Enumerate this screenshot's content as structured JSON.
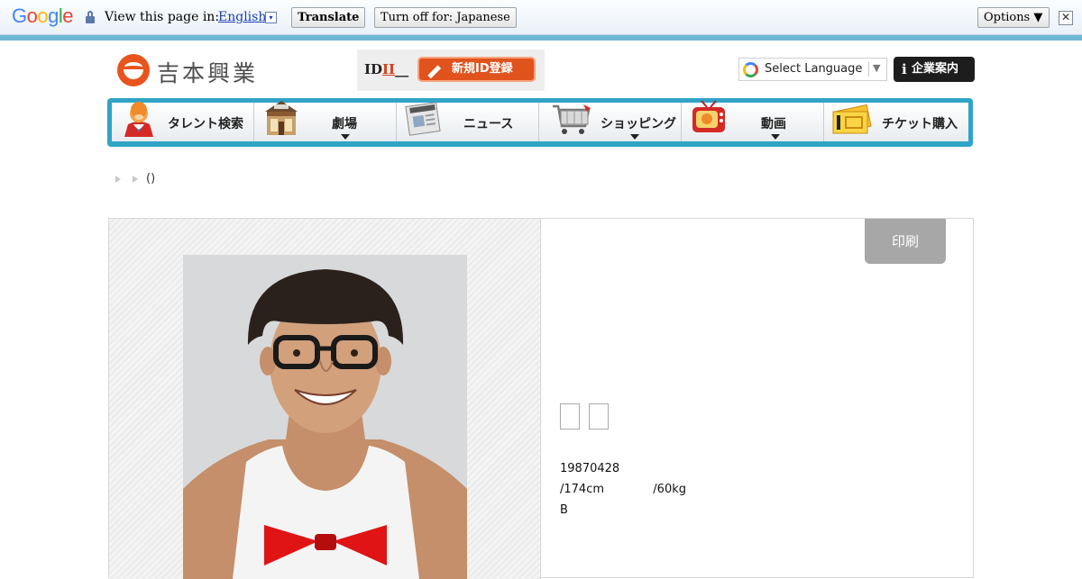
{
  "translate_bar": {
    "brand": "Google",
    "prompt": "View this page in:",
    "language": "English",
    "language_dropdown": "▾",
    "translate_label": "Translate",
    "turn_off_label": "Turn off for: Japanese",
    "options_label": "Options ▼",
    "close_label": "✕"
  },
  "header": {
    "logo_text": "吉本興業",
    "id_prefix": "ID",
    "id_suffix": "II",
    "register_label": "新規ID登録",
    "language_select": "Select Language",
    "language_arrow": "▼",
    "corporate_label": "企業案内",
    "corporate_icon": "i"
  },
  "nav": {
    "items": [
      {
        "label": "タレント検索",
        "icon": "talent-search-icon",
        "has_dropdown": false
      },
      {
        "label": "劇場",
        "icon": "theater-icon",
        "has_dropdown": true
      },
      {
        "label": "ニュース",
        "icon": "news-icon",
        "has_dropdown": false
      },
      {
        "label": "ショッピング",
        "icon": "shopping-cart-icon",
        "has_dropdown": true
      },
      {
        "label": "動画",
        "icon": "tv-icon",
        "has_dropdown": true
      },
      {
        "label": "チケット購入",
        "icon": "ticket-icon",
        "has_dropdown": false
      }
    ]
  },
  "breadcrumb": {
    "text": "()"
  },
  "profile": {
    "print_label": "印刷",
    "birthdate": "19870428",
    "height": "/174cm",
    "weight": "/60kg",
    "blood_type": "B"
  },
  "colors": {
    "accent_orange": "#e0531d",
    "nav_blue": "#2fa4c6",
    "print_gray": "#a7a7a7"
  }
}
